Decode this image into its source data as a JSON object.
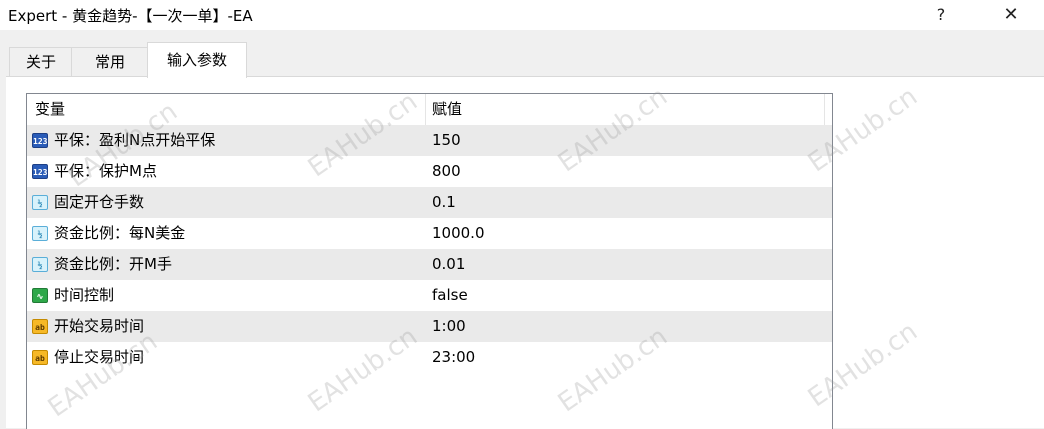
{
  "window": {
    "title": "Expert - 黄金趋势-【一次一单】-EA",
    "help_label": "?",
    "close_label": "✕"
  },
  "tabs": [
    {
      "label": "关于",
      "active": false
    },
    {
      "label": "常用",
      "active": false
    },
    {
      "label": "输入参数",
      "active": true
    }
  ],
  "table": {
    "headers": {
      "variable": "变量",
      "value": "赋值"
    },
    "rows": [
      {
        "icon": "integer-icon",
        "badge": "123",
        "name": "平保：盈利N点开始平保",
        "value": "150"
      },
      {
        "icon": "integer-icon",
        "badge": "123",
        "name": "平保：保护M点",
        "value": "800"
      },
      {
        "icon": "double-icon",
        "badge": "½",
        "name": "固定开仓手数",
        "value": "0.1"
      },
      {
        "icon": "double-icon",
        "badge": "½",
        "name": "资金比例：每N美金",
        "value": "1000.0"
      },
      {
        "icon": "double-icon",
        "badge": "½",
        "name": "资金比例：开M手",
        "value": "0.01"
      },
      {
        "icon": "bool-icon",
        "badge": "∿",
        "name": "时间控制",
        "value": "false"
      },
      {
        "icon": "string-icon",
        "badge": "ab",
        "name": "开始交易时间",
        "value": "1:00"
      },
      {
        "icon": "string-icon",
        "badge": "ab",
        "name": "停止交易时间",
        "value": "23:00"
      }
    ]
  },
  "watermark": "EAHub.cn",
  "colors": {
    "row_alt": "#eaeaea",
    "window_bg": "#f0f0f0"
  }
}
